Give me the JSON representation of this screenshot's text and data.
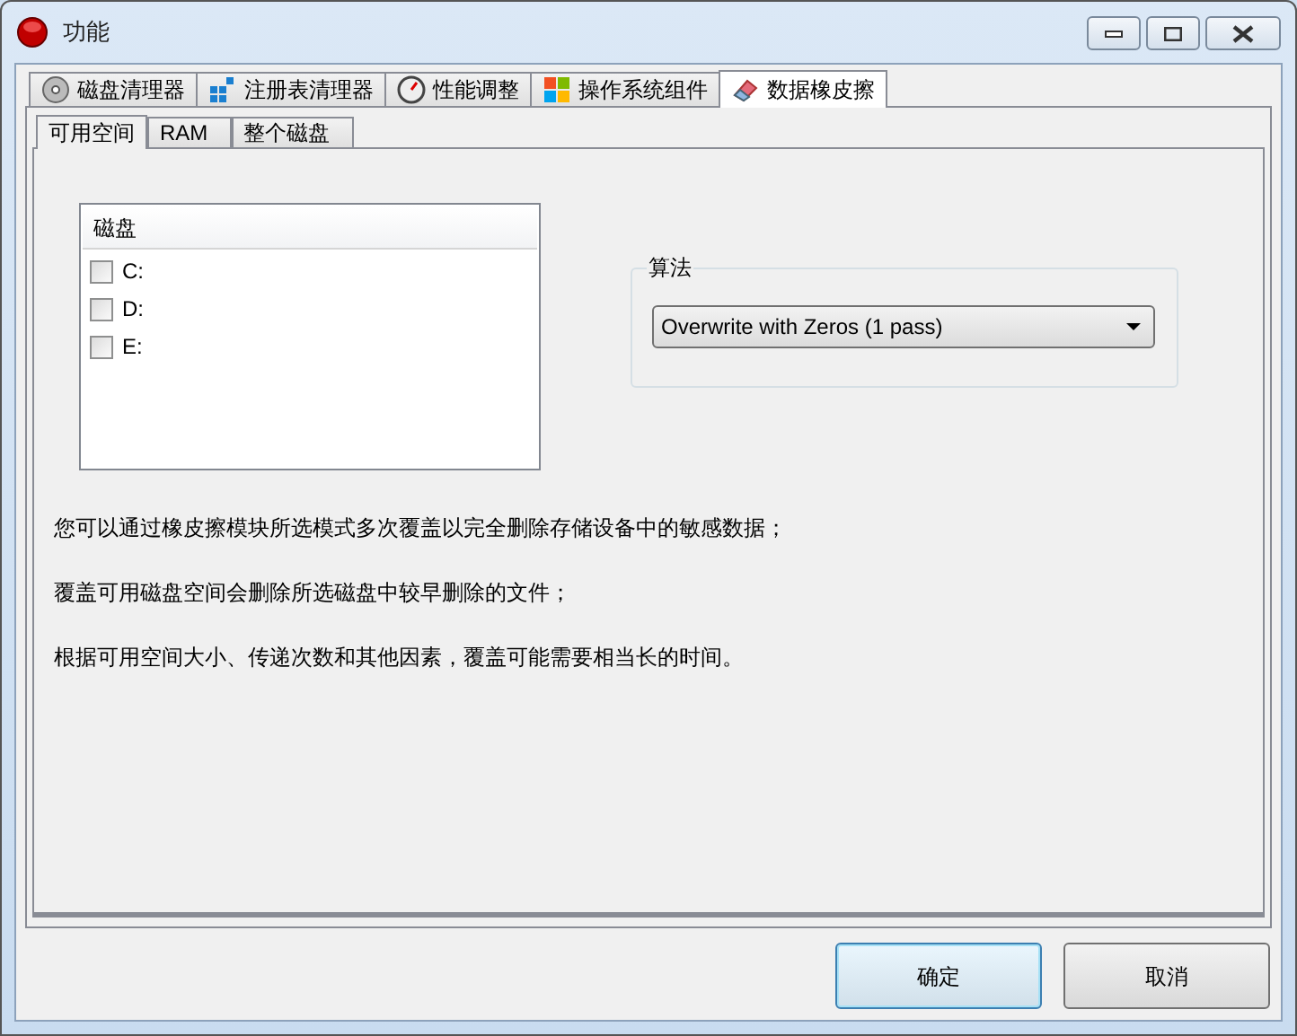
{
  "window": {
    "title": "功能"
  },
  "tabs": [
    {
      "label": "磁盘清理器",
      "kind": "disc",
      "selected": false
    },
    {
      "label": "注册表清理器",
      "kind": "blocks",
      "selected": false
    },
    {
      "label": "性能调整",
      "kind": "gauge",
      "selected": false
    },
    {
      "label": "操作系统组件",
      "kind": "windows",
      "selected": false
    },
    {
      "label": "数据橡皮擦",
      "kind": "eraser",
      "selected": true
    }
  ],
  "subtabs": [
    {
      "label": "可用空间",
      "selected": true
    },
    {
      "label": "RAM",
      "selected": false
    },
    {
      "label": "整个磁盘",
      "selected": false
    }
  ],
  "disk_list": {
    "header": "磁盘",
    "items": [
      {
        "label": "C:",
        "checked": false
      },
      {
        "label": "D:",
        "checked": false
      },
      {
        "label": "E:",
        "checked": false
      }
    ]
  },
  "algorithm": {
    "legend": "算法",
    "value": "Overwrite with Zeros (1 pass)"
  },
  "notes": [
    "您可以通过橡皮擦模块所选模式多次覆盖以完全删除存储设备中的敏感数据；",
    "覆盖可用磁盘空间会删除所选磁盘中较早删除的文件；",
    "根据可用空间大小、传递次数和其他因素，覆盖可能需要相当长的时间。"
  ],
  "buttons": [
    {
      "label": "确定",
      "focused": true
    },
    {
      "label": "取消",
      "focused": false
    }
  ]
}
